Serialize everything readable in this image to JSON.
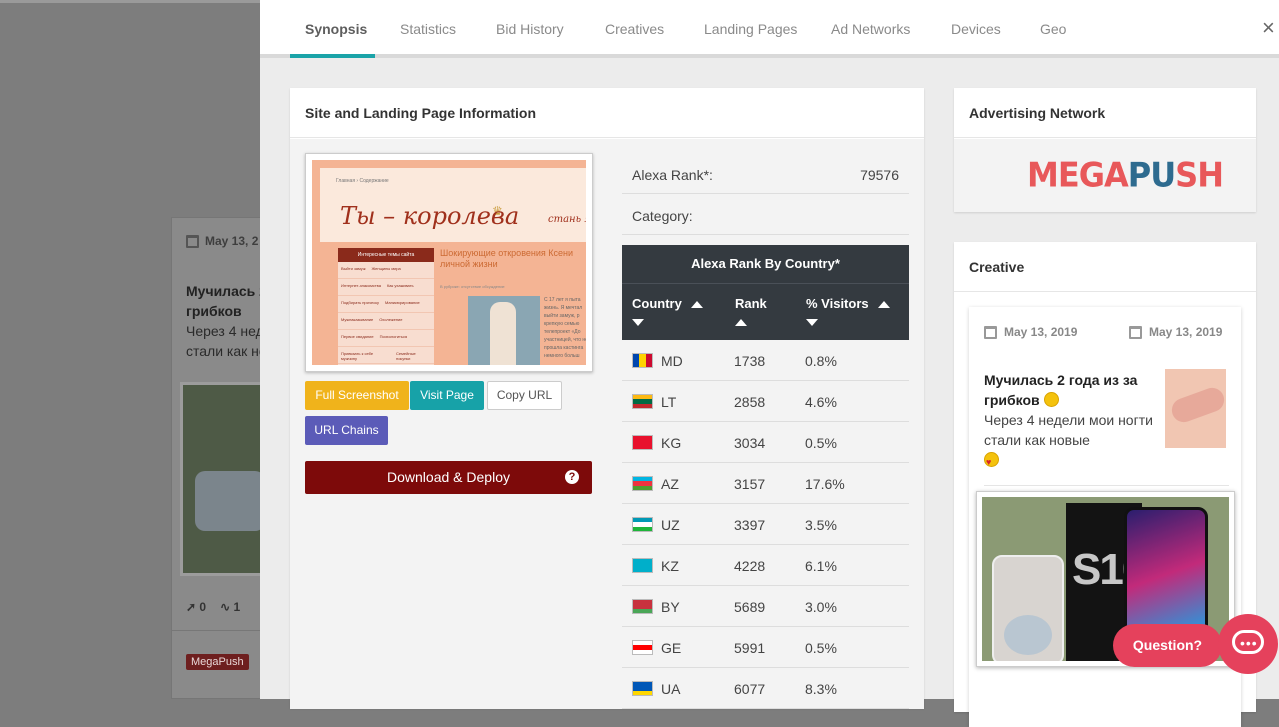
{
  "background_card": {
    "date": "May 13, 2",
    "title": "Мучилась 2 грибков",
    "desc": "Через 4 неде стали как но",
    "stats": [
      "0",
      "1"
    ],
    "badge": "MegaPush"
  },
  "tabs": [
    "Synopsis",
    "Statistics",
    "Bid History",
    "Creatives",
    "Landing Pages",
    "Ad Networks",
    "Devices",
    "Geo"
  ],
  "active_tab": "Synopsis",
  "close_label": "×",
  "site_panel": {
    "title": "Site and Landing Page Information",
    "screenshot": {
      "crumbs": "Главная  ›  Содержание",
      "logo": "Ты – королева",
      "logo_sub": "стань я",
      "menu_head": "Интересные темы сайта",
      "menu_rows": [
        [
          "Выйти замуж",
          "Женщины мира"
        ],
        [
          "Интернет-знакомства",
          "Как ухаживать"
        ],
        [
          "Подбирать прическу",
          "Маникюрирование"
        ],
        [
          "Мужнаказывание",
          "Охолежение"
        ],
        [
          "Первое свидание",
          "Психологиться"
        ],
        [
          "Привязать к себе мужчину",
          "Семейные покупки"
        ]
      ],
      "headline": "Шокирующие откровения Ксени личной жизни",
      "meta": "В рубрике: отсутствие обсуждение",
      "side_text": "С 17 лет я пыта жизнь. Я мечтал выйти замуж, р крепкую семью телепроект «До участницей, что не прошла кастинга немного больш"
    },
    "buttons": {
      "full_screenshot": "Full Screenshot",
      "visit_page": "Visit Page",
      "copy_url": "Copy URL",
      "url_chains": "URL Chains",
      "download_deploy": "Download & Deploy",
      "help": "?"
    },
    "alexa_rank_label": "Alexa Rank*:",
    "alexa_rank_value": "79576",
    "category_label": "Category:",
    "category_value": "",
    "country_table": {
      "title": "Alexa Rank By Country*",
      "headers": [
        "Country",
        "Rank",
        "% Visitors"
      ],
      "rows": [
        {
          "code": "MD",
          "rank": "1738",
          "visitors": "0.8%",
          "flag": [
            "#0046ae",
            "#ffd200",
            "#cc092f"
          ],
          "flag_dir": "vertical"
        },
        {
          "code": "LT",
          "rank": "2858",
          "visitors": "4.6%",
          "flag": [
            "#fdb913",
            "#006a44",
            "#c1272d"
          ],
          "flag_dir": "horizontal"
        },
        {
          "code": "KG",
          "rank": "3034",
          "visitors": "0.5%",
          "flag": [
            "#e8112d",
            "#e8112d",
            "#e8112d"
          ],
          "flag_dir": "horizontal"
        },
        {
          "code": "AZ",
          "rank": "3157",
          "visitors": "17.6%",
          "flag": [
            "#00b5e2",
            "#ef3340",
            "#509e2f"
          ],
          "flag_dir": "horizontal"
        },
        {
          "code": "UZ",
          "rank": "3397",
          "visitors": "3.5%",
          "flag": [
            "#0099b5",
            "#ffffff",
            "#1eb53a"
          ],
          "flag_dir": "horizontal"
        },
        {
          "code": "KZ",
          "rank": "4228",
          "visitors": "6.1%",
          "flag": [
            "#00afca",
            "#00afca",
            "#00afca"
          ],
          "flag_dir": "horizontal"
        },
        {
          "code": "BY",
          "rank": "5689",
          "visitors": "3.0%",
          "flag": [
            "#c8313e",
            "#c8313e",
            "#4aa657"
          ],
          "flag_dir": "horizontal"
        },
        {
          "code": "GE",
          "rank": "5991",
          "visitors": "0.5%",
          "flag": [
            "#ffffff",
            "#ff0000",
            "#ffffff"
          ],
          "flag_dir": "horizontal"
        },
        {
          "code": "UA",
          "rank": "6077",
          "visitors": "8.3%",
          "flag": [
            "#0057b7",
            "#0057b7",
            "#ffd700"
          ],
          "flag_dir": "horizontal"
        }
      ]
    }
  },
  "ad_network": {
    "title": "Advertising Network",
    "logo_text_a": "MEGA",
    "logo_text_b": "PU",
    "logo_text_c": "SH"
  },
  "creative": {
    "title": "Creative",
    "date_first": "May 13, 2019",
    "date_last": "May 13, 2019",
    "headline": "Мучилась 2 года из за грибков",
    "description": "Через 4 недели мои ногти стали как новые",
    "image_text": "S10"
  },
  "chat": {
    "question_label": "Question?",
    "dots": "•••"
  }
}
